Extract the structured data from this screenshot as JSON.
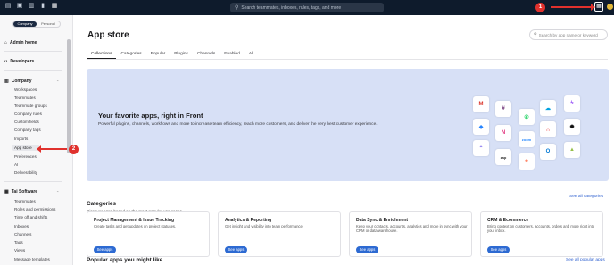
{
  "topbar": {
    "icons": [
      "inbox-icon",
      "contacts-icon",
      "documents-icon",
      "analytics-icon",
      "grid-icon"
    ],
    "search_placeholder": "Search teammates, inboxes, rules, tags, and more",
    "marker_number": "1"
  },
  "sidebar": {
    "toggle": {
      "company": "Company",
      "personal": "Personal"
    },
    "admin_home": "Admin home",
    "developers": "Developers",
    "company_section": "Company",
    "company_items": [
      "Workspaces",
      "Teammates",
      "Teammate groups",
      "Company rules",
      "Custom fields",
      "Company tags",
      "Imports",
      "App store",
      "Preferences",
      "AI",
      "Deliverability"
    ],
    "selected_item": "App store",
    "marker_number": "2",
    "workspace_section": "Tai Software",
    "workspace_items": [
      "Teammates",
      "Roles and permissions",
      "Time off and shifts",
      "Inboxes",
      "Channels",
      "Tags",
      "Views",
      "Message templates"
    ]
  },
  "main": {
    "title": "App store",
    "search_placeholder": "Search by app name or keyword",
    "tabs": [
      "Collections",
      "Categories",
      "Popular",
      "Plugins",
      "Channels",
      "Enabled",
      "All"
    ],
    "active_tab": "Collections",
    "hero": {
      "title": "Your favorite apps, right in Front",
      "subtitle": "Powerful plugins, channels, workflows and more to increase team efficiency, reach more customers, and deliver the very best customer experience.",
      "app_tiles": [
        "gmail",
        "slack",
        "whatsapp",
        "salesforce",
        "messenger",
        "jira",
        "notion",
        "zoom",
        "asana",
        "openai",
        "clickup",
        "zapier",
        "hubspot",
        "outlook",
        "shopify"
      ]
    },
    "categories": {
      "title": "Categories",
      "subtitle": "Discover apps based on the most popular use cases.",
      "see_all": "See all categories",
      "cards": [
        {
          "title": "Project Management & Issue Tracking",
          "desc": "Create tasks and get updates on project statuses.",
          "button": "See apps"
        },
        {
          "title": "Analytics & Reporting",
          "desc": "Get insight and visibility into team performance.",
          "button": "See apps"
        },
        {
          "title": "Data Sync & Enrichment",
          "desc": "Keep your contacts, accounts, analytics and more in sync with your CRM or data warehouse.",
          "button": "See apps"
        },
        {
          "title": "CRM & Ecommerce",
          "desc": "Bring context on customers, accounts, orders and more right into your inbox.",
          "button": "See apps"
        }
      ]
    },
    "popular": {
      "title": "Popular apps you might like",
      "see_all": "See all popular apps"
    }
  }
}
